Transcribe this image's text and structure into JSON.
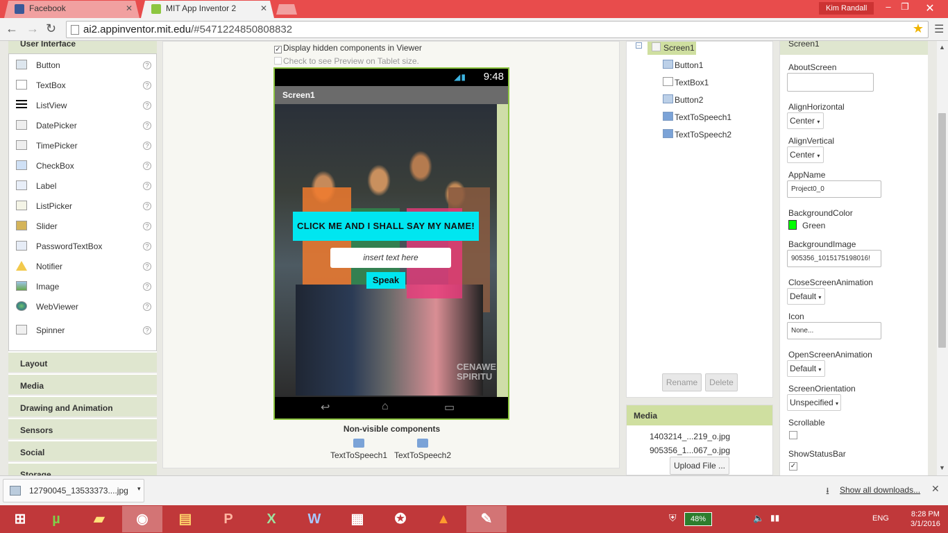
{
  "browser": {
    "tabs": [
      {
        "title": "Facebook",
        "icon": "facebook-icon",
        "color": "#3b5998"
      },
      {
        "title": "MIT App Inventor 2",
        "icon": "appinventor-icon",
        "color": "#8dc640"
      }
    ],
    "user": "Kim Randall",
    "url_host": "ai2.appinventor.mit.edu",
    "url_path": "/#5471224850808832"
  },
  "palette": {
    "header": "User Interface",
    "items": [
      {
        "label": "Button",
        "icon": "button-icon"
      },
      {
        "label": "TextBox",
        "icon": "textbox-icon"
      },
      {
        "label": "ListView",
        "icon": "listview-icon"
      },
      {
        "label": "DatePicker",
        "icon": "datepicker-icon"
      },
      {
        "label": "TimePicker",
        "icon": "timepicker-icon"
      },
      {
        "label": "CheckBox",
        "icon": "checkbox-icon"
      },
      {
        "label": "Label",
        "icon": "label-icon"
      },
      {
        "label": "ListPicker",
        "icon": "listpicker-icon"
      },
      {
        "label": "Slider",
        "icon": "slider-icon"
      },
      {
        "label": "PasswordTextBox",
        "icon": "password-icon"
      },
      {
        "label": "Notifier",
        "icon": "notifier-icon"
      },
      {
        "label": "Image",
        "icon": "image-icon"
      },
      {
        "label": "WebViewer",
        "icon": "webviewer-icon"
      },
      {
        "label": "Spinner",
        "icon": "spinner-icon"
      }
    ],
    "help": "?",
    "drawers": [
      "Layout",
      "Media",
      "Drawing and Animation",
      "Sensors",
      "Social",
      "Storage"
    ]
  },
  "viewer": {
    "show_hidden_label": "Display hidden components in Viewer",
    "show_hidden_checked": true,
    "tablet_label": "Check to see Preview on Tablet size.",
    "tablet_checked": false,
    "phone": {
      "time": "9:48",
      "title": "Screen1",
      "button1_text": "CLICK ME AND I SHALL SAY MY NAME!",
      "textbox_hint": "insert text here",
      "button2_text": "Speak",
      "watermark": "CENAWE\nSPIRITU"
    },
    "nonvisible_title": "Non-visible components",
    "nonvisible": [
      "TextToSpeech1",
      "TextToSpeech2"
    ]
  },
  "components": {
    "root": "Screen1",
    "children": [
      "Button1",
      "TextBox1",
      "Button2",
      "TextToSpeech1",
      "TextToSpeech2"
    ],
    "rename_label": "Rename",
    "delete_label": "Delete"
  },
  "media": {
    "header": "Media",
    "files": [
      "1403214_...219_o.jpg",
      "905356_1...067_o.jpg"
    ],
    "upload_label": "Upload File ..."
  },
  "properties": {
    "header": "Screen1",
    "about_label": "AboutScreen",
    "about_value": "",
    "align_h_label": "AlignHorizontal",
    "align_h_value": "Center",
    "align_v_label": "AlignVertical",
    "align_v_value": "Center",
    "appname_label": "AppName",
    "appname_value": "Project0_0",
    "bgcolor_label": "BackgroundColor",
    "bgcolor_value": "Green",
    "bgcolor_hex": "#00ff00",
    "bgimage_label": "BackgroundImage",
    "bgimage_value": "905356_1015175198016!",
    "close_anim_label": "CloseScreenAnimation",
    "close_anim_value": "Default",
    "icon_label": "Icon",
    "icon_value": "None...",
    "open_anim_label": "OpenScreenAnimation",
    "open_anim_value": "Default",
    "orientation_label": "ScreenOrientation",
    "orientation_value": "Unspecified",
    "scrollable_label": "Scrollable",
    "scrollable_checked": false,
    "statusbar_label": "ShowStatusBar",
    "statusbar_checked": true
  },
  "downloads": {
    "file": "12790045_13533373....jpg",
    "show_all": "Show all downloads..."
  },
  "taskbar": {
    "apps": [
      "windows-start-icon",
      "utorrent-icon",
      "sticky-notes-icon",
      "chrome-icon",
      "file-explorer-icon",
      "powerpoint-icon",
      "excel-icon",
      "word-icon",
      "calculator-icon",
      "counter-strike-icon",
      "vlc-icon",
      "paint-icon"
    ],
    "battery": "48%",
    "lang": "ENG",
    "time": "8:28 PM",
    "date": "3/1/2016"
  }
}
